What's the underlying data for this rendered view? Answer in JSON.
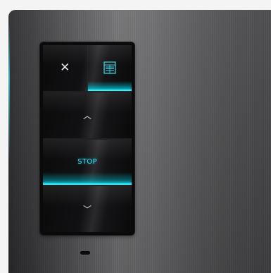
{
  "device": {
    "accent_color": "#2ef0ff",
    "plate_color": "#5a5a5c",
    "buttons": {
      "close": {
        "icon": "close-icon",
        "glyph": "✕"
      },
      "menu": {
        "icon": "list-icon"
      },
      "up": {
        "icon": "chevron-up-icon",
        "glyph": "︿"
      },
      "stop": {
        "label": "STOP"
      },
      "down": {
        "icon": "chevron-down-icon",
        "glyph": "﹀"
      }
    },
    "status_led": {
      "state": "off"
    }
  }
}
